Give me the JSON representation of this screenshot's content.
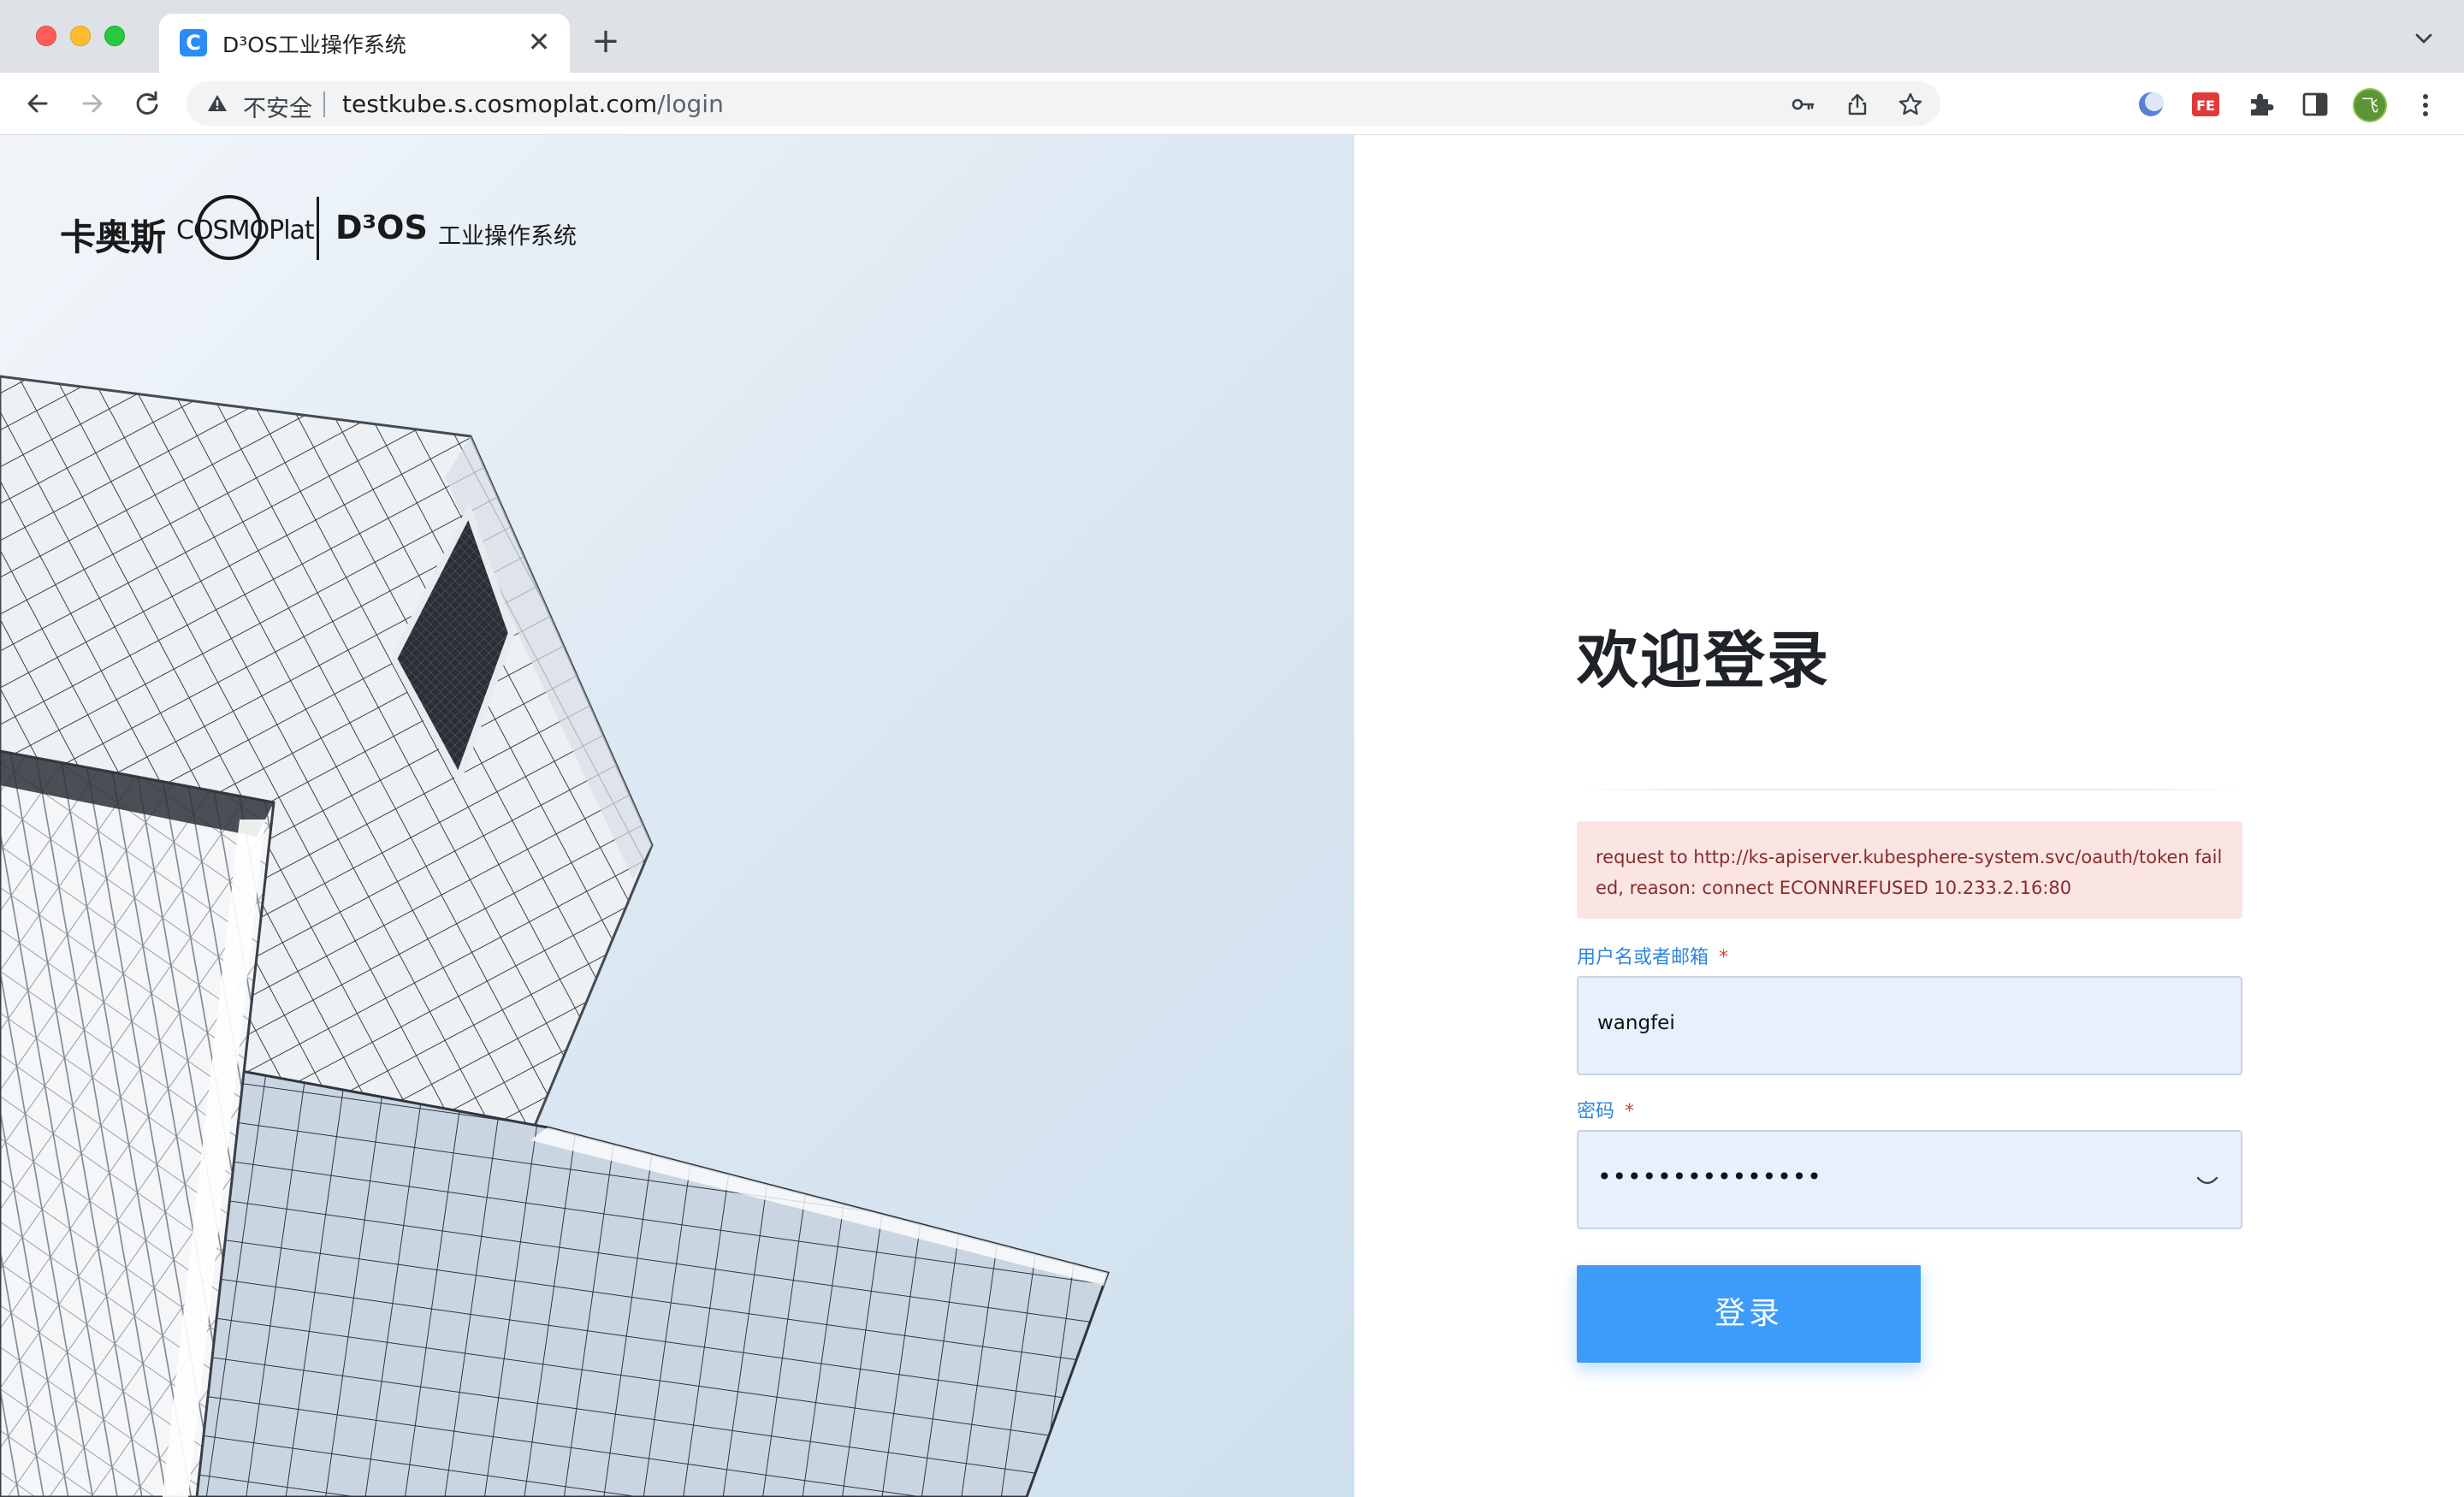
{
  "browser": {
    "tab": {
      "favicon_letter": "C",
      "title": "D³OS工业操作系统",
      "close_glyph": "✕"
    },
    "new_tab_glyph": "+",
    "omnibox": {
      "security_label": "不安全",
      "url_host": "testkube.s.cosmoplat.com",
      "url_path": "/login"
    },
    "profile_initial": "飞"
  },
  "brand": {
    "kaos": "卡奥斯",
    "cosmoplat": "COSMOPlat",
    "d3os": "D³OS",
    "subtitle": "工业操作系统"
  },
  "login": {
    "heading": "欢迎登录",
    "error_message": "request to http://ks-apiserver.kubesphere-system.svc/oauth/token failed, reason: connect ECONNREFUSED 10.233.2.16:80",
    "username_label": "用户名或者邮箱",
    "username_value": "wangfei",
    "password_label": "密码",
    "password_value": "•••••••••••••••",
    "required_mark": "*",
    "submit_label": "登录"
  },
  "colors": {
    "accent": "#3d9bf9",
    "label": "#2e86de",
    "required": "#e0403a",
    "error_bg": "#fae5e3",
    "error_text": "#8a2b2b",
    "input_bg": "#e8effd"
  },
  "icons": {
    "back": "back-arrow-icon",
    "forward": "forward-arrow-icon",
    "reload": "reload-icon",
    "warning": "warning-icon",
    "key": "key-icon",
    "share": "share-icon",
    "star": "star-icon",
    "extensions": "puzzle-icon",
    "sidepanel": "side-panel-icon",
    "menu": "kebab-menu-icon",
    "eye": "eye-closed-icon"
  }
}
